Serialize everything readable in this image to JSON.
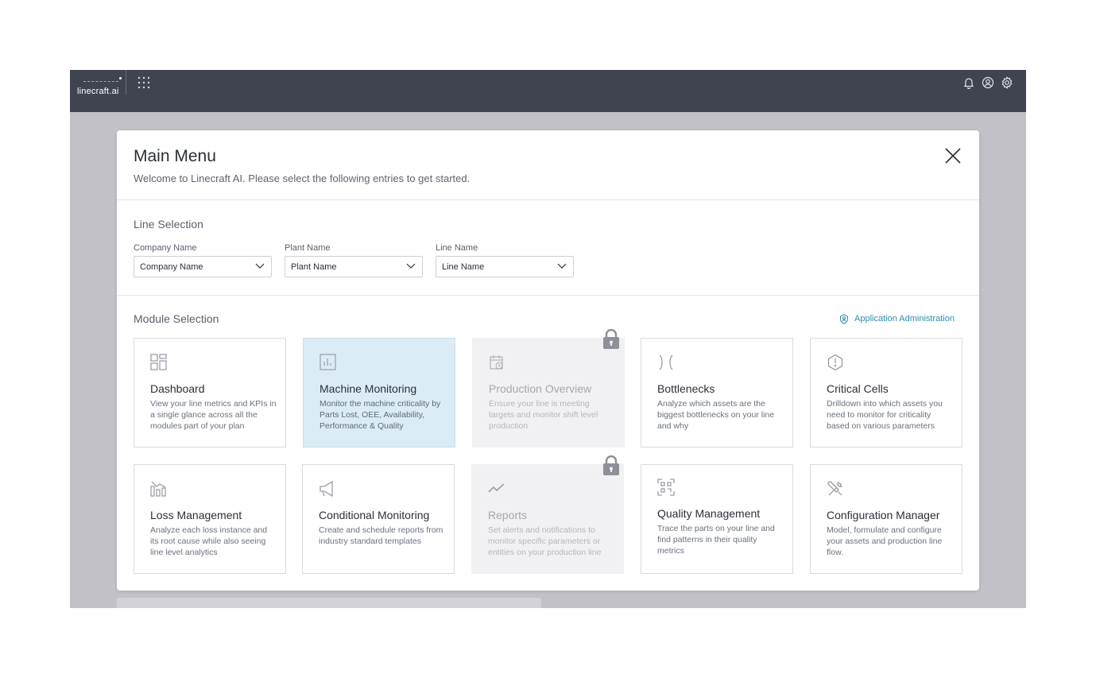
{
  "topbar": {
    "logo_text": "linecraft.ai",
    "icons": [
      "apps-grid-icon",
      "bell-icon",
      "user-icon",
      "gear-icon"
    ]
  },
  "modal": {
    "title": "Main Menu",
    "subtitle": "Welcome to Linecraft AI. Please select the following entries to get started.",
    "line_selection": {
      "title": "Line Selection",
      "fields": [
        {
          "label": "Company Name",
          "value": "Company Name"
        },
        {
          "label": "Plant Name",
          "value": "Plant Name"
        },
        {
          "label": "Line Name",
          "value": "Line Name"
        }
      ]
    },
    "module_selection": {
      "title": "Module Selection",
      "admin_link": "Application Administration",
      "modules": [
        {
          "title": "Dashboard",
          "description": "View your line metrics and KPIs in a single glance across all the modules part of your plan",
          "icon": "dashboard-icon",
          "state": "default"
        },
        {
          "title": "Machine Monitoring",
          "description": "Monitor the machine criticality by Parts Lost, OEE, Availability, Performance & Quality",
          "icon": "bar-chart-icon",
          "state": "selected"
        },
        {
          "title": "Production Overview",
          "description": "Ensure your line is meeting targets and monitor shift level production",
          "icon": "calendar-clock-icon",
          "state": "locked"
        },
        {
          "title": "Bottlenecks",
          "description": "Analyze which assets are the biggest bottlenecks on your line and why",
          "icon": "bottleneck-icon",
          "state": "default"
        },
        {
          "title": "Critical Cells",
          "description": "Drilldown into which assets you need to monitor for criticality based on various parameters",
          "icon": "alert-hexagon-icon",
          "state": "default"
        },
        {
          "title": "Loss Management",
          "description": "Analyze each loss instance and its root cause while also seeing line level analytics",
          "icon": "loss-chart-icon",
          "state": "default"
        },
        {
          "title": "Conditional Monitoring",
          "description": "Create and schedule reports from industry standard templates",
          "icon": "megaphone-icon",
          "state": "default"
        },
        {
          "title": "Reports",
          "description": "Set alerts and notifications to monitor specific parameters or entities on your production line",
          "icon": "trend-line-icon",
          "state": "locked"
        },
        {
          "title": "Quality Management",
          "description": "Trace the parts on your line and find patterns in their quality metrics",
          "icon": "scan-icon",
          "state": "default"
        },
        {
          "title": "Configuration Manager",
          "description": "Model, formulate and configure your assets and production line flow.",
          "icon": "tools-icon",
          "state": "default"
        }
      ]
    }
  },
  "colors": {
    "topbar": "#404350",
    "backdrop": "#c2c1c7",
    "selected_card": "#dcecf7",
    "locked_card": "#f1f1f3",
    "link": "#2a8fb1"
  }
}
